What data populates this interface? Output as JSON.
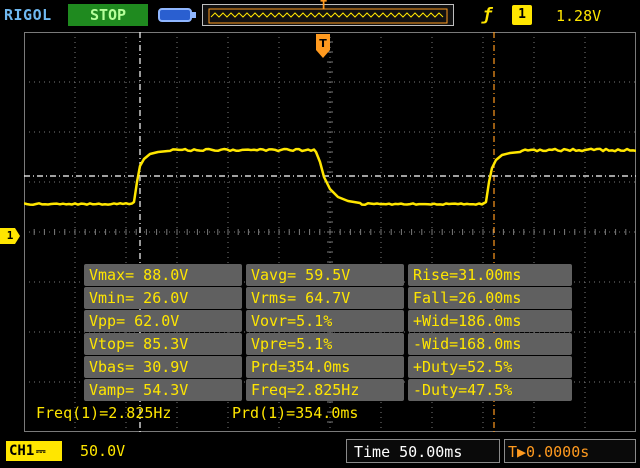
{
  "header": {
    "brand": "RIGOL",
    "run_state": "STOP",
    "trigger_badge": "T",
    "trigger_edge_icon": "rising-edge",
    "trigger_channel": "1",
    "trigger_level": "1.28V"
  },
  "screen": {
    "trigger_marker": "T",
    "channel_marker": "1"
  },
  "measurements": {
    "rows": [
      [
        "Vmax= 88.0V",
        "Vavg= 59.5V",
        "Rise=31.00ms"
      ],
      [
        "Vmin= 26.0V",
        "Vrms= 64.7V",
        "Fall=26.00ms"
      ],
      [
        "Vpp= 62.0V",
        "Vovr=5.1%",
        "+Wid=186.0ms"
      ],
      [
        "Vtop= 85.3V",
        "Vpre=5.1%",
        "-Wid=168.0ms"
      ],
      [
        "Vbas= 30.9V",
        "Prd=354.0ms",
        "+Duty=52.5%"
      ],
      [
        "Vamp= 54.3V",
        "Freq=2.825Hz",
        "-Duty=47.5%"
      ]
    ],
    "freq": "Freq(1)=2.825Hz",
    "period": "Prd(1)=354.0ms"
  },
  "footer": {
    "channel": "CH1",
    "coupling_icon": "dc-coupling",
    "volts_per_div": "50.0V",
    "timebase": "Time 50.00ms",
    "trigger_position": "T▶0.0000s"
  },
  "colors": {
    "trace": "#ffe600",
    "grid": "#7a7a7a",
    "trigger": "#ff9a1f",
    "brand": "#6fb8f0",
    "stop_bg": "#1f8a1f"
  }
}
